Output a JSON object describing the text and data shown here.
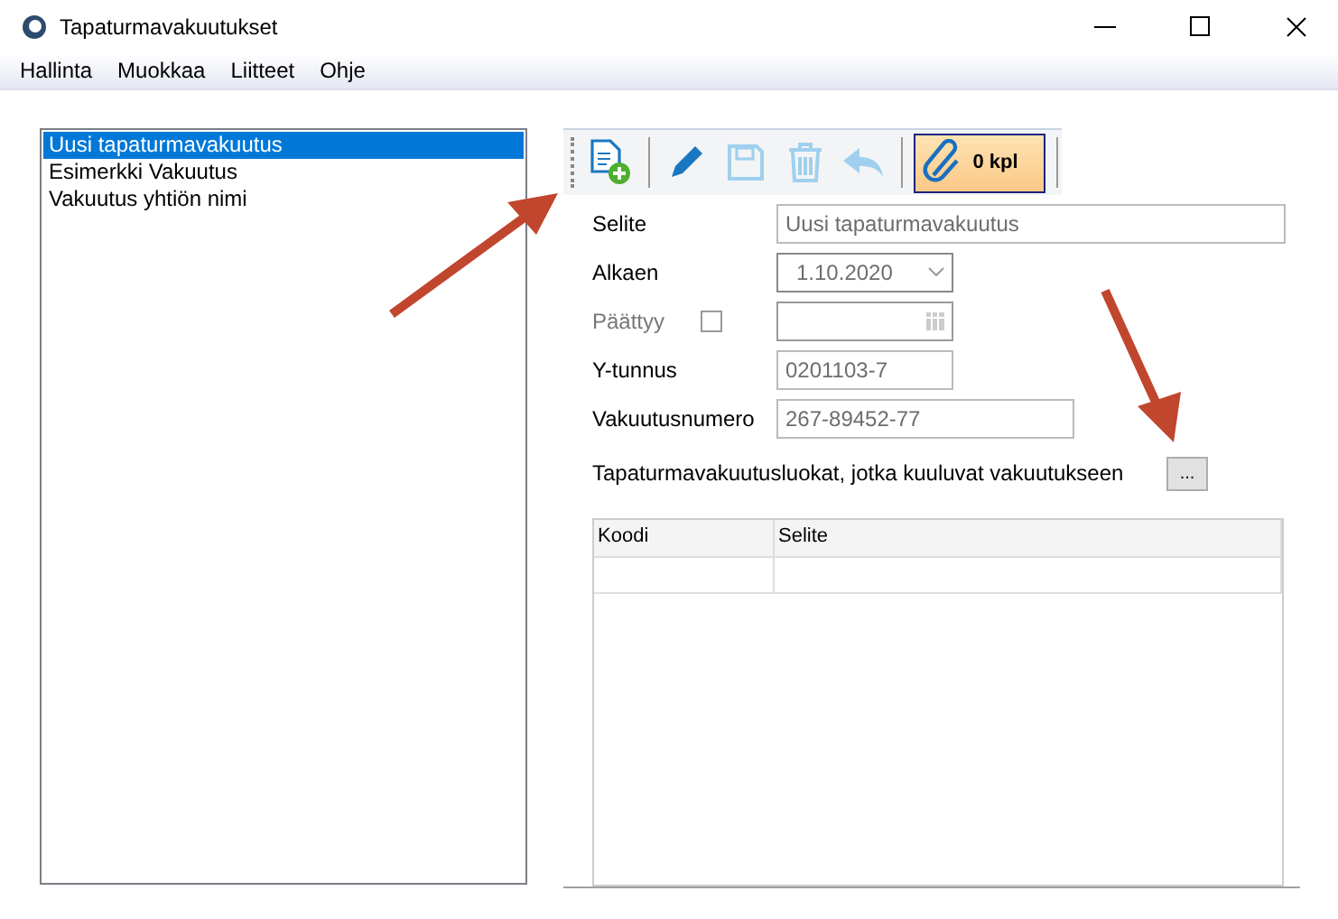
{
  "window": {
    "title": "Tapaturmavakuutukset"
  },
  "menu": [
    "Hallinta",
    "Muokkaa",
    "Liitteet",
    "Ohje"
  ],
  "list": [
    {
      "label": "Uusi tapaturmavakuutus",
      "selected": true
    },
    {
      "label": "Esimerkki Vakuutus",
      "selected": false
    },
    {
      "label": "Vakuutus yhtiön nimi",
      "selected": false
    }
  ],
  "toolbar": {
    "buttons": [
      {
        "kind": "new",
        "disabled": false
      },
      {
        "kind": "edit",
        "disabled": false
      },
      {
        "kind": "save",
        "disabled": true
      },
      {
        "kind": "delete",
        "disabled": true
      },
      {
        "kind": "undo",
        "disabled": true
      }
    ],
    "attachments": "0 kpl"
  },
  "form": [
    {
      "kind": "text",
      "label": "Selite",
      "value": "Uusi tapaturmavakuutus"
    },
    {
      "kind": "dropdown",
      "label": "Alkaen",
      "value": "1.10.2020"
    },
    {
      "kind": "date-check",
      "label": "Päättyy",
      "checked": false,
      "disabled": true
    },
    {
      "kind": "text",
      "label": "Y-tunnus",
      "value": "0201103-7"
    },
    {
      "kind": "text",
      "label": "Vakuutusnumero",
      "value": "267-89452-77"
    }
  ],
  "classes": {
    "label": "Tapaturmavakuutusluokat, jotka kuuluvat vakuutukseen",
    "button": "...",
    "columns": [
      "Koodi",
      "Selite"
    ]
  },
  "annotations": [
    {
      "kind": "arrow"
    },
    {
      "kind": "arrow"
    }
  ]
}
